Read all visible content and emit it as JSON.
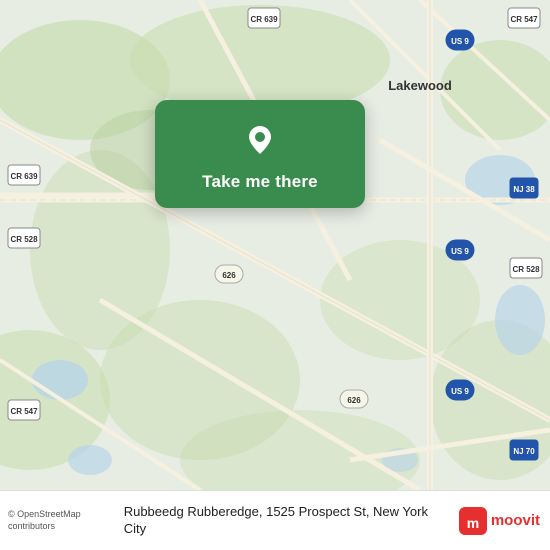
{
  "map": {
    "attribution": "© OpenStreetMap contributors",
    "background_color": "#e8efe8"
  },
  "action_card": {
    "label": "Take me there",
    "pin_icon": "location-pin"
  },
  "bottom_bar": {
    "address": "Rubbeedg Rubberedge, 1525 Prospect St, New York City",
    "logo_text": "moovit",
    "logo_icon": "moovit-icon"
  }
}
